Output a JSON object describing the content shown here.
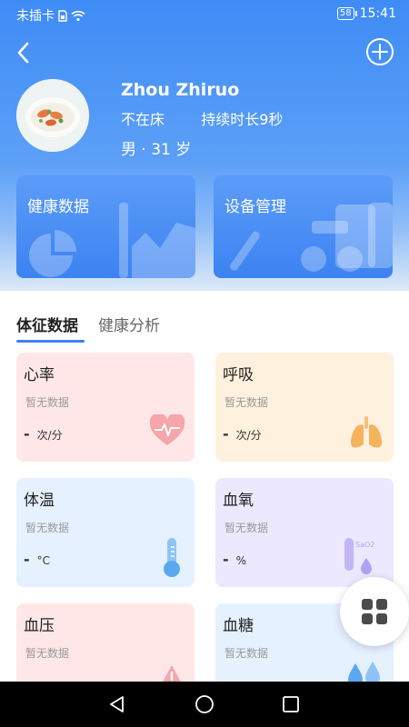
{
  "status_bar": {
    "carrier": "未插卡",
    "battery": "58",
    "time": "15:41"
  },
  "profile": {
    "name": "Zhou Zhiruo",
    "bed_status": "不在床",
    "duration": "持续时长9秒",
    "gender_age": "男 · 31 岁"
  },
  "quick_cards": [
    {
      "label": "健康数据"
    },
    {
      "label": "设备管理"
    }
  ],
  "tabs": [
    {
      "label": "体征数据",
      "active": true
    },
    {
      "label": "健康分析",
      "active": false
    }
  ],
  "metrics": [
    {
      "title": "心率",
      "status": "暂无数据",
      "value": "-",
      "unit": "次/分",
      "icon": "heart-icon",
      "color": "#ffe7e8"
    },
    {
      "title": "呼吸",
      "status": "暂无数据",
      "value": "-",
      "unit": "次/分",
      "icon": "lungs-icon",
      "color": "#fff1dd"
    },
    {
      "title": "体温",
      "status": "暂无数据",
      "value": "-",
      "unit": "°C",
      "icon": "thermometer-icon",
      "color": "#e6f1ff"
    },
    {
      "title": "血氧",
      "status": "暂无数据",
      "value": "-",
      "unit": "%",
      "icon": "spo2-test-tube-icon",
      "color": "#ece8ff",
      "icon_text": "SaO2"
    },
    {
      "title": "血压",
      "status": "暂无数据",
      "icon": "blood-pressure-icon",
      "color": "#ffe7e8"
    },
    {
      "title": "血糖",
      "status": "暂无数据",
      "icon": "blood-drops-icon",
      "color": "#e6f1ff"
    }
  ]
}
